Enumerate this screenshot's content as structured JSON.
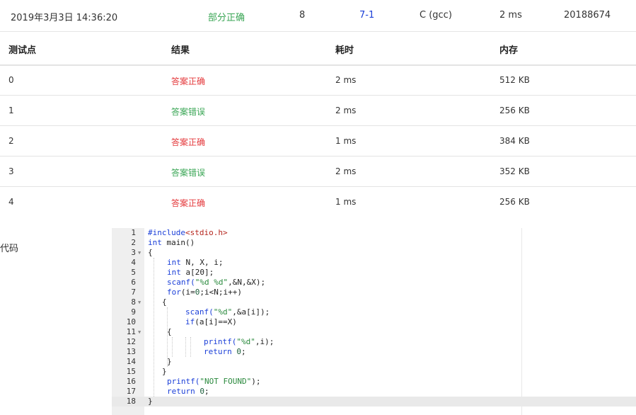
{
  "submission": {
    "time": "2019年3月3日 14:36:20",
    "status": "部分正确",
    "score": "8",
    "problem": "7-1",
    "compiler": "C (gcc)",
    "duration": "2 ms",
    "user": "20188674"
  },
  "table": {
    "headers": [
      "测试点",
      "结果",
      "耗时",
      "内存"
    ],
    "rows": [
      {
        "id": "0",
        "result": "答案正确",
        "time": "2 ms",
        "memory": "512 KB"
      },
      {
        "id": "1",
        "result": "答案错误",
        "time": "2 ms",
        "memory": "256 KB"
      },
      {
        "id": "2",
        "result": "答案正确",
        "time": "1 ms",
        "memory": "384 KB"
      },
      {
        "id": "3",
        "result": "答案错误",
        "time": "2 ms",
        "memory": "352 KB"
      },
      {
        "id": "4",
        "result": "答案正确",
        "time": "1 ms",
        "memory": "256 KB"
      }
    ]
  },
  "code_label": "代码",
  "code": {
    "line_numbers": [
      "1",
      "2",
      "3",
      "4",
      "5",
      "6",
      "7",
      "8",
      "9",
      "10",
      "11",
      "12",
      "13",
      "14",
      "15",
      "16",
      "17",
      "18"
    ],
    "fold_marker": "▼",
    "l1": {
      "a": "#include",
      "b": "<stdio.h>"
    },
    "l2": {
      "a": "int",
      "b": " main()"
    },
    "l3": {
      "a": "{"
    },
    "l4": {
      "a": "int",
      "b": " N, X, i;"
    },
    "l5": {
      "a": "int",
      "b": " a[20];"
    },
    "l6": {
      "a": "scanf(",
      "b": "\"%d %d\"",
      "c": ",&N,&X);"
    },
    "l7": {
      "a": "for",
      "b": "(i=",
      "c": "0",
      "d": ";i<N;i++)"
    },
    "l8": {
      "a": "{"
    },
    "l9": {
      "a": "scanf(",
      "b": "\"%d\"",
      "c": ",&a[i]);"
    },
    "l10": {
      "a": "if",
      "b": "(a[i]==X)"
    },
    "l11": {
      "a": "{"
    },
    "l12": {
      "a": "printf(",
      "b": "\"%d\"",
      "c": ",i);"
    },
    "l13": {
      "a": "return",
      "b": " ",
      "c": "0",
      "d": ";"
    },
    "l14": {
      "a": "}"
    },
    "l15": {
      "a": "}"
    },
    "l16": {
      "a": "printf(",
      "b": "\"NOT FOUND\"",
      "c": ");"
    },
    "l17": {
      "a": "return",
      "b": " ",
      "c": "0",
      "d": ";"
    },
    "l18": {
      "a": "}"
    }
  },
  "colors": {
    "pass": "#e4393c",
    "fail": "#3aa655",
    "partial": "#3aa655",
    "link": "#1b3fd8"
  }
}
